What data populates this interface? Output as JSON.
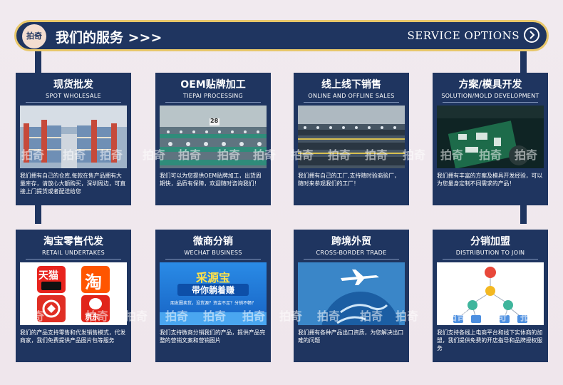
{
  "header": {
    "logo": "拍奇",
    "title": "我们的服务 >>>",
    "service_label": "SERVICE OPTIONS"
  },
  "watermark": "拍奇",
  "cards": [
    {
      "title": "现货批发",
      "subtitle": "SPOT WHOLESALE",
      "desc": "我们拥有自己的仓库,每款在售产品拥有大量库存，请放心大额购买，深圳周边，可直接上门提货或者配送给您"
    },
    {
      "title": "OEM贴牌加工",
      "subtitle": "TIEPAI PROCESSING",
      "desc": "我们可以为您提供OEM贴牌加工，出货周期快，品质有保障，欢迎随时咨询我们！",
      "img_tag": "28"
    },
    {
      "title": "线上线下销售",
      "subtitle": "ONLINE AND OFFLINE SALES",
      "desc": "我们拥有自己的工厂,支持随时验商验厂，随时来参观我们的工厂！"
    },
    {
      "title": "方案/模具开发",
      "subtitle": "SOLUTION/MOLD DEVELOPMENT",
      "desc": "我们拥有丰富的方案及模具开发经验，可以为您量身定制不同需求的产品！"
    },
    {
      "title": "淘宝零售代发",
      "subtitle": "RETAIL UNDERTAKES",
      "desc": "我们的产品支持零售和代发销售模式，代发商家，我们免费提供产品图片包等服务",
      "logos": {
        "tmall": "天猫",
        "tao": "淘",
        "jd": "京东"
      }
    },
    {
      "title": "微商分销",
      "subtitle": "WECHAT BUSINESS",
      "desc": "我们支持微商分销我们的产品，提供产品完整的营销文案和营销图片",
      "banner": {
        "line1": "采源宝",
        "line2": "带你躺着赚",
        "line3": "朋友圈卖货，没货源？资金不足？分销不畅？"
      }
    },
    {
      "title": "跨境外贸",
      "subtitle": "CROSS-BORDER TRADE",
      "desc": "我们拥有各种产品出口资质，为您解决出口难的问题"
    },
    {
      "title": "分销加盟",
      "subtitle": "DISTRIBUTION TO JOIN",
      "desc": "我们支持各线上电商平台和线下实体商的加盟，我们提供免费的开店指导和品牌授权服务"
    }
  ]
}
